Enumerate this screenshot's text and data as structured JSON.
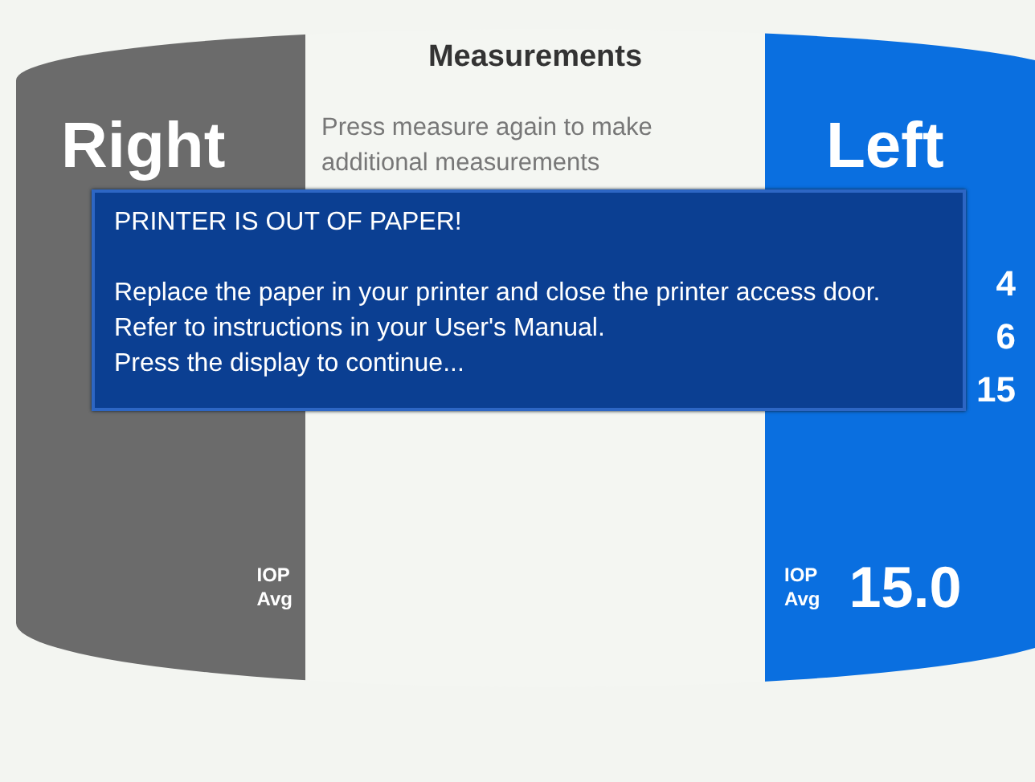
{
  "header": {
    "title": "Measurements",
    "instruction": "Press measure again to make additional measurements"
  },
  "eyes": [
    {
      "label": "Right",
      "selected": false,
      "avg_label": "IOP Avg"
    },
    {
      "label": "Left",
      "selected": true,
      "readings": [
        "4",
        "6",
        "15"
      ],
      "avg_label": "IOP Avg",
      "avg_value": "15.0"
    }
  ],
  "dialog": {
    "title": "PRINTER IS OUT OF PAPER!",
    "lines": [
      "Replace the paper in your printer and close the printer access door.",
      "Refer to instructions in your User's Manual.",
      "Press the display to continue..."
    ]
  }
}
